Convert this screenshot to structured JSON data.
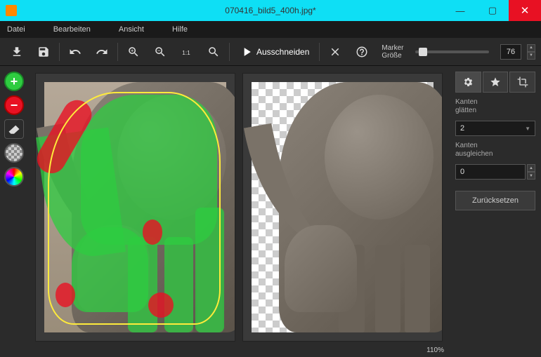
{
  "window": {
    "title": "070416_bild5_400h.jpg*"
  },
  "menu": {
    "file": "Datei",
    "edit": "Bearbeiten",
    "view": "Ansicht",
    "help": "Hilfe"
  },
  "toolbar": {
    "cut_label": "Ausschneiden",
    "marker_label_1": "Marker",
    "marker_label_2": "Größe",
    "marker_value": "76"
  },
  "right_panel": {
    "smooth_label_1": "Kanten",
    "smooth_label_2": "glätten",
    "smooth_value": "2",
    "offset_label_1": "Kanten",
    "offset_label_2": "ausgleichen",
    "offset_value": "0",
    "reset_label": "Zurücksetzen"
  },
  "status": {
    "zoom": "110%"
  }
}
